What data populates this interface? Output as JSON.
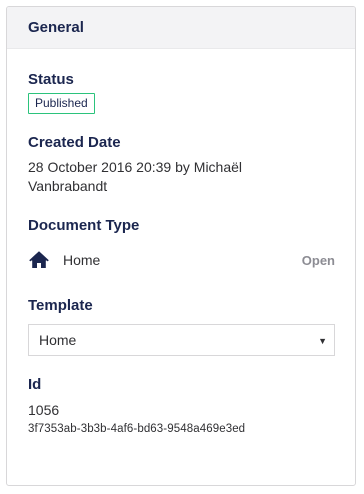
{
  "panel": {
    "title": "General"
  },
  "status": {
    "label": "Status",
    "value": "Published",
    "badge_border_color": "#2bc37c"
  },
  "created": {
    "label": "Created Date",
    "value": "28 October 2016 20:39 by Michaël Vanbrabandt"
  },
  "document_type": {
    "label": "Document Type",
    "icon": "home-icon",
    "name": "Home",
    "open_label": "Open"
  },
  "template": {
    "label": "Template",
    "selected": "Home"
  },
  "id": {
    "label": "Id",
    "number": "1056",
    "guid": "3f7353ab-3b3b-4af6-bd63-9548a469e3ed"
  }
}
